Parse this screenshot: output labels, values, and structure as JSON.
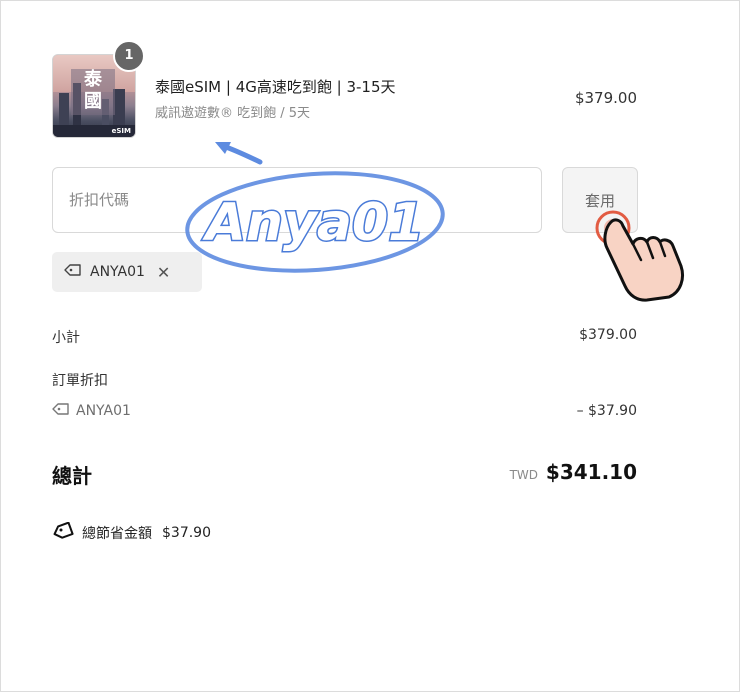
{
  "product": {
    "quantity": "1",
    "thumbnail_caption_line1": "泰",
    "thumbnail_caption_line2": "國",
    "thumbnail_brand": "eSIM",
    "title": "泰國eSIM | 4G高速吃到飽 | 3-15天",
    "subtitle": "威訊遨遊數® 吃到飽 / 5天",
    "price": "$379.00"
  },
  "discount": {
    "placeholder": "折扣代碼",
    "value": "",
    "apply_label": "套用",
    "applied_code": "ANYA01",
    "remove_symbol": "✕"
  },
  "summary": {
    "subtotal_label": "小計",
    "subtotal_value": "$379.00",
    "order_discount_label": "訂單折扣",
    "discount_code": "ANYA01",
    "discount_value": "– $37.90",
    "total_label": "總計",
    "currency": "TWD",
    "total_value": "$341.10",
    "savings_label": "總節省金額",
    "savings_value": "$37.90"
  },
  "overlay": {
    "watermark_text": "Anya01"
  },
  "icons": {
    "tag": "tag-icon",
    "close": "close-icon",
    "savings": "savings-tag-icon",
    "pointer": "pointing-hand-icon"
  },
  "colors": {
    "watermark_blue": "#4a7bd8",
    "click_ring": "#e25c43",
    "hand_fill": "#f8d3c4"
  }
}
